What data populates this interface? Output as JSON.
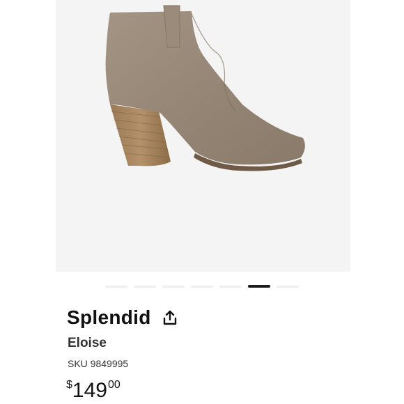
{
  "product": {
    "brand": "Splendid",
    "model": "Eloise",
    "sku": "SKU 9849995",
    "price": {
      "currency": "$",
      "whole": "149",
      "cents": "00"
    }
  },
  "carousel": {
    "total_slides": 7,
    "active_index": 5
  },
  "icons": {
    "share": "share-upload-icon"
  },
  "colors": {
    "image_background": "#f4f4f4",
    "active_dot": "#1a1a1a",
    "inactive_dot": "#eeeeee",
    "text": "#111111"
  }
}
